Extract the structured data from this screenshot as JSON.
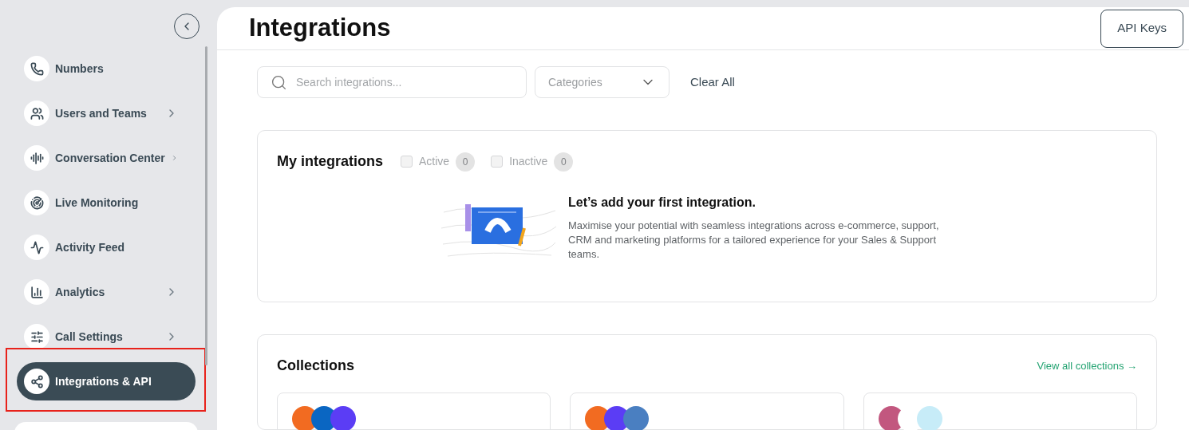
{
  "sidebar": {
    "items": [
      {
        "label": "Numbers",
        "expandable": false,
        "selected": false
      },
      {
        "label": "Users and Teams",
        "expandable": true,
        "selected": false
      },
      {
        "label": "Conversation Center",
        "expandable": true,
        "selected": false
      },
      {
        "label": "Live Monitoring",
        "expandable": false,
        "selected": false
      },
      {
        "label": "Activity Feed",
        "expandable": false,
        "selected": false
      },
      {
        "label": "Analytics",
        "expandable": true,
        "selected": false
      },
      {
        "label": "Call Settings",
        "expandable": true,
        "selected": false
      },
      {
        "label": "Integrations & API",
        "expandable": false,
        "selected": true
      }
    ]
  },
  "header": {
    "title": "Integrations",
    "button": "API Keys"
  },
  "filters": {
    "search_placeholder": "Search integrations...",
    "categories": "Categories",
    "clear": "Clear All"
  },
  "my_integrations": {
    "title": "My integrations",
    "filters": [
      {
        "label": "Active",
        "checked": false,
        "count": "0"
      },
      {
        "label": "Inactive",
        "checked": false,
        "count": "0"
      }
    ],
    "empty_title": "Let’s add your first integration.",
    "empty_text": "Maximise your potential with seamless integrations across e-commerce, support, CRM and marketing platforms for a tailored experience for your Sales & Support teams."
  },
  "collections": {
    "title": "Collections",
    "link": "View all collections →",
    "cards": [
      {
        "logos": [
          {
            "color": "#f26b21"
          },
          {
            "color": "#0a66c2"
          },
          {
            "color": "#5b3df5"
          }
        ]
      },
      {
        "logos": [
          {
            "color": "#f26b21"
          },
          {
            "color": "#5b3df5"
          },
          {
            "color": "#4a7fc1"
          }
        ]
      },
      {
        "logos": [
          {
            "color": "#c2577f"
          },
          {
            "color": "#ffffff"
          },
          {
            "color": "#c7ecf8"
          }
        ]
      }
    ]
  }
}
